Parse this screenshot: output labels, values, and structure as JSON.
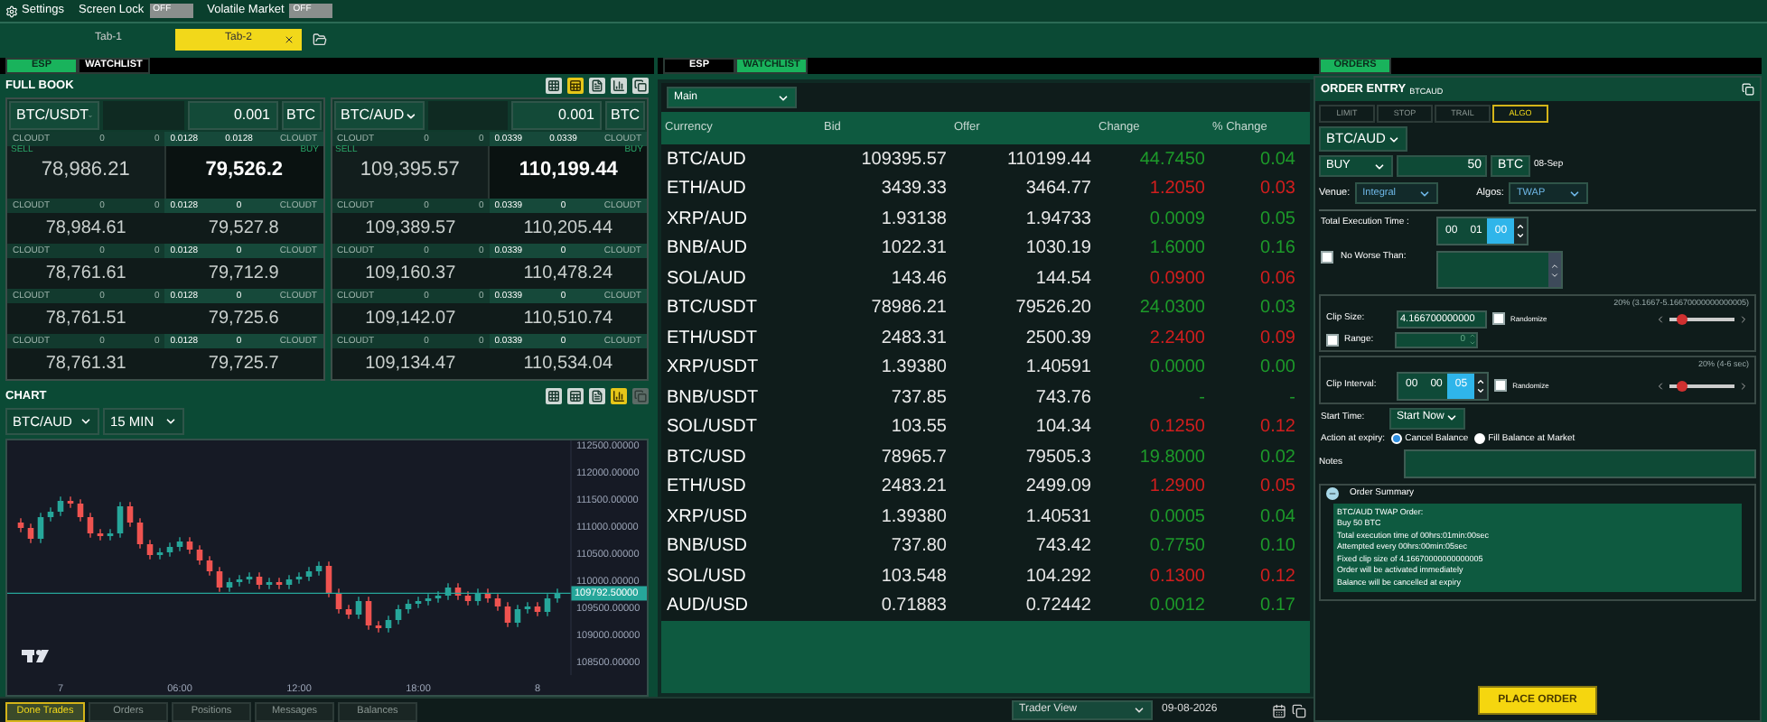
{
  "top_bar": {
    "settings": "Settings",
    "toggles": [
      {
        "label": "Screen Lock",
        "on": false,
        "state_text": "OFF"
      },
      {
        "label": "Volatile Market",
        "on": false,
        "state_text": "OFF"
      }
    ]
  },
  "workspace_tabs": [
    {
      "label": "Tab-1",
      "selected": false
    },
    {
      "label": "Tab-2",
      "selected": true
    }
  ],
  "left": {
    "tabs": [
      {
        "label": "ESP",
        "selected": true
      },
      {
        "label": "WATCHLIST",
        "selected": false
      }
    ],
    "full_book": {
      "title": "FULL BOOK",
      "tools": [
        {
          "kind": "grid",
          "selected": false,
          "disabled": false
        },
        {
          "kind": "sheet",
          "selected": true,
          "disabled": false
        },
        {
          "kind": "doc",
          "selected": false,
          "disabled": false
        },
        {
          "kind": "chart",
          "selected": false,
          "disabled": false
        },
        {
          "kind": "windows",
          "selected": false,
          "disabled": false
        }
      ],
      "books": [
        {
          "pair": "BTC/USDT",
          "quantity": "0.001",
          "unit": "BTC",
          "sell_label": "SELL",
          "buy_label": "BUY",
          "levels": [
            {
              "strip": [
                "CLOUDT",
                "0",
                "0",
                "0.0128",
                "0.0128",
                "CLOUDT"
              ],
              "sell": "78,986.21",
              "buy": "79,526.2"
            },
            {
              "strip": [
                "CLOUDT",
                "0",
                "0",
                "0.0128",
                "0",
                "CLOUDT"
              ],
              "sell": "78,984.61",
              "buy": "79,527.8"
            },
            {
              "strip": [
                "CLOUDT",
                "0",
                "0",
                "0.0128",
                "0",
                "CLOUDT"
              ],
              "sell": "78,761.61",
              "buy": "79,712.9"
            },
            {
              "strip": [
                "CLOUDT",
                "0",
                "0",
                "0.0128",
                "0",
                "CLOUDT"
              ],
              "sell": "78,761.51",
              "buy": "79,725.6"
            },
            {
              "strip": [
                "CLOUDT",
                "0",
                "0",
                "0.0128",
                "0",
                "CLOUDT"
              ],
              "sell": "78,761.31",
              "buy": "79,725.7"
            }
          ]
        },
        {
          "pair": "BTC/AUD",
          "quantity": "0.001",
          "unit": "BTC",
          "sell_label": "SELL",
          "buy_label": "BUY",
          "levels": [
            {
              "strip": [
                "CLOUDT",
                "0",
                "0",
                "0.0339",
                "0.0339",
                "CLOUDT"
              ],
              "sell": "109,395.57",
              "buy": "110,199.44"
            },
            {
              "strip": [
                "CLOUDT",
                "0",
                "0",
                "0.0339",
                "0",
                "CLOUDT"
              ],
              "sell": "109,389.57",
              "buy": "110,205.44"
            },
            {
              "strip": [
                "CLOUDT",
                "0",
                "0",
                "0.0339",
                "0",
                "CLOUDT"
              ],
              "sell": "109,160.37",
              "buy": "110,478.24"
            },
            {
              "strip": [
                "CLOUDT",
                "0",
                "0",
                "0.0339",
                "0",
                "CLOUDT"
              ],
              "sell": "109,142.07",
              "buy": "110,510.74"
            },
            {
              "strip": [
                "CLOUDT",
                "0",
                "0",
                "0.0339",
                "0",
                "CLOUDT"
              ],
              "sell": "109,134.47",
              "buy": "110,534.04"
            }
          ]
        }
      ]
    },
    "chart": {
      "title": "CHART",
      "tools": [
        {
          "kind": "grid",
          "selected": false,
          "disabled": false
        },
        {
          "kind": "sheet",
          "selected": false,
          "disabled": false
        },
        {
          "kind": "doc",
          "selected": false,
          "disabled": false
        },
        {
          "kind": "chart",
          "selected": true,
          "disabled": false
        },
        {
          "kind": "windows",
          "selected": false,
          "disabled": true
        }
      ],
      "pair": "BTC/AUD",
      "interval": "15 MIN",
      "chart_data": {
        "type": "candlestick",
        "ref_lines": [
          {
            "axis": "y",
            "value": 109792.5,
            "label": "109792.50000"
          }
        ],
        "categories": [
          null,
          null,
          null,
          null,
          "7",
          null,
          null,
          null,
          null,
          null,
          null,
          null,
          null,
          null,
          null,
          null,
          "06:00",
          null,
          null,
          null,
          null,
          null,
          null,
          null,
          null,
          null,
          null,
          null,
          "12:00",
          null,
          null,
          null,
          null,
          null,
          null,
          null,
          null,
          null,
          null,
          null,
          "18:00",
          null,
          null,
          null,
          null,
          null,
          null,
          null,
          null,
          null,
          null,
          null,
          "8",
          null,
          null
        ],
        "ohlc": [
          [
            111100,
            111180,
            110920,
            111000
          ],
          [
            111000,
            111080,
            110720,
            110800
          ],
          [
            110800,
            111280,
            110720,
            111200
          ],
          [
            111200,
            111380,
            111120,
            111300
          ],
          [
            111300,
            111580,
            111220,
            111500
          ],
          [
            111500,
            111580,
            111370,
            111450
          ],
          [
            111450,
            111530,
            111120,
            111200
          ],
          [
            111200,
            111280,
            110820,
            110900
          ],
          [
            110900,
            110980,
            110770,
            110850
          ],
          [
            110850,
            110980,
            110770,
            110900
          ],
          [
            110900,
            111480,
            110820,
            111400
          ],
          [
            111400,
            111480,
            111020,
            111100
          ],
          [
            111100,
            111180,
            110620,
            110700
          ],
          [
            110700,
            110780,
            110420,
            110500
          ],
          [
            110500,
            110630,
            110420,
            110550
          ],
          [
            110550,
            110730,
            110470,
            110650
          ],
          [
            110650,
            110830,
            110570,
            110750
          ],
          [
            110750,
            110830,
            110520,
            110600
          ],
          [
            110600,
            110680,
            110320,
            110400
          ],
          [
            110400,
            110480,
            110120,
            110200
          ],
          [
            110200,
            110280,
            109820,
            109900
          ],
          [
            109900,
            110080,
            109820,
            110000
          ],
          [
            110000,
            110130,
            109920,
            110050
          ],
          [
            110050,
            110180,
            109970,
            110100
          ],
          [
            110100,
            110180,
            109870,
            109950
          ],
          [
            109950,
            110080,
            109870,
            110000
          ],
          [
            110000,
            110080,
            109870,
            109950
          ],
          [
            109950,
            110130,
            109870,
            110050
          ],
          [
            110050,
            110180,
            109970,
            110100
          ],
          [
            110100,
            110280,
            110020,
            110200
          ],
          [
            110200,
            110380,
            110120,
            110300
          ],
          [
            110300,
            110380,
            109720,
            109800
          ],
          [
            109800,
            109880,
            109420,
            109500
          ],
          [
            109500,
            109580,
            109320,
            109400
          ],
          [
            109400,
            109730,
            109320,
            109650
          ],
          [
            109650,
            109730,
            109120,
            109200
          ],
          [
            109200,
            109280,
            109070,
            109150
          ],
          [
            109150,
            109380,
            109070,
            109300
          ],
          [
            109300,
            109580,
            109220,
            109500
          ],
          [
            109500,
            109680,
            109420,
            109600
          ],
          [
            109600,
            109730,
            109520,
            109650
          ],
          [
            109650,
            109780,
            109570,
            109700
          ],
          [
            109700,
            109830,
            109620,
            109750
          ],
          [
            109750,
            109980,
            109670,
            109900
          ],
          [
            109900,
            109980,
            109670,
            109750
          ],
          [
            109750,
            109830,
            109570,
            109650
          ],
          [
            109650,
            109880,
            109570,
            109800
          ],
          [
            109800,
            109880,
            109620,
            109700
          ],
          [
            109700,
            109780,
            109470,
            109550
          ],
          [
            109550,
            109630,
            109170,
            109250
          ],
          [
            109250,
            109580,
            109170,
            109500
          ],
          [
            109500,
            109630,
            109420,
            109550
          ],
          [
            109550,
            109630,
            109370,
            109450
          ],
          [
            109450,
            109780,
            109370,
            109700
          ],
          [
            109700,
            109880,
            109620,
            109800
          ]
        ],
        "ylim": [
          108350,
          112550
        ],
        "yticks": [
          {
            "value": 112500,
            "label": "112500.00000"
          },
          {
            "value": 112000,
            "label": "112000.00000"
          },
          {
            "value": 111500,
            "label": "111500.00000"
          },
          {
            "value": 111000,
            "label": "111000.00000"
          },
          {
            "value": 110500,
            "label": "110500.00000"
          },
          {
            "value": 110000,
            "label": "110000.00000"
          },
          {
            "value": 109500,
            "label": "109500.00000"
          },
          {
            "value": 109000,
            "label": "109000.00000"
          },
          {
            "value": 108500,
            "label": "108500.00000"
          }
        ]
      }
    }
  },
  "watchlist": {
    "tabs": [
      {
        "label": "ESP",
        "selected": false
      },
      {
        "label": "WATCHLIST",
        "selected": true
      }
    ],
    "list": "Main",
    "columns": [
      "Currency",
      "Bid",
      "Offer",
      "Change",
      "% Change"
    ],
    "rows": [
      {
        "cells": [
          "BTC/AUD",
          "109395.57",
          "110199.44",
          "44.7450",
          "0.04"
        ],
        "color": "#1d9a2a"
      },
      {
        "cells": [
          "ETH/AUD",
          "3439.33",
          "3464.77",
          "1.2050",
          "0.03"
        ],
        "color": "#d21e1e"
      },
      {
        "cells": [
          "XRP/AUD",
          "1.93138",
          "1.94733",
          "0.0009",
          "0.05"
        ],
        "color": "#1d9a2a"
      },
      {
        "cells": [
          "BNB/AUD",
          "1022.31",
          "1030.19",
          "1.6000",
          "0.16"
        ],
        "color": "#1d9a2a"
      },
      {
        "cells": [
          "SOL/AUD",
          "143.46",
          "144.54",
          "0.0900",
          "0.06"
        ],
        "color": "#d21e1e"
      },
      {
        "cells": [
          "BTC/USDT",
          "78986.21",
          "79526.20",
          "24.0300",
          "0.03"
        ],
        "color": "#1d9a2a"
      },
      {
        "cells": [
          "ETH/USDT",
          "2483.31",
          "2500.39",
          "2.2400",
          "0.09"
        ],
        "color": "#d21e1e"
      },
      {
        "cells": [
          "XRP/USDT",
          "1.39380",
          "1.40591",
          "0.0000",
          "0.00"
        ],
        "color": "#1d9a2a"
      },
      {
        "cells": [
          "BNB/USDT",
          "737.85",
          "743.76",
          "-",
          "-"
        ],
        "color": "#1d9a2a"
      },
      {
        "cells": [
          "SOL/USDT",
          "103.55",
          "104.34",
          "0.1250",
          "0.12"
        ],
        "color": "#d21e1e"
      },
      {
        "cells": [
          "BTC/USD",
          "78965.7",
          "79505.3",
          "19.8000",
          "0.02"
        ],
        "color": "#1d9a2a"
      },
      {
        "cells": [
          "ETH/USD",
          "2483.21",
          "2499.09",
          "1.2900",
          "0.05"
        ],
        "color": "#d21e1e"
      },
      {
        "cells": [
          "XRP/USD",
          "1.39380",
          "1.40531",
          "0.0005",
          "0.04"
        ],
        "color": "#1d9a2a"
      },
      {
        "cells": [
          "BNB/USD",
          "737.80",
          "743.42",
          "0.7750",
          "0.10"
        ],
        "color": "#1d9a2a"
      },
      {
        "cells": [
          "SOL/USD",
          "103.548",
          "104.292",
          "0.1300",
          "0.12"
        ],
        "color": "#d21e1e"
      },
      {
        "cells": [
          "AUD/USD",
          "0.71883",
          "0.72442",
          "0.0012",
          "0.17"
        ],
        "color": "#1d9a2a"
      }
    ]
  },
  "bottom_tabs": [
    {
      "label": "Done Trades",
      "selected": true
    },
    {
      "label": "Orders",
      "selected": false
    },
    {
      "label": "Positions",
      "selected": false
    },
    {
      "label": "Messages",
      "selected": false
    },
    {
      "label": "Balances",
      "selected": false
    }
  ],
  "footer": {
    "view": "Trader View",
    "date": "09-08-2026"
  },
  "orders": {
    "tabs": [
      {
        "label": "ORDERS",
        "selected": true
      }
    ],
    "title": "ORDER ENTRY",
    "subtitle": "BTCAUD",
    "order_types": [
      {
        "label": "LIMIT",
        "selected": false
      },
      {
        "label": "STOP",
        "selected": false
      },
      {
        "label": "TRAIL",
        "selected": false
      },
      {
        "label": "ALGO",
        "selected": true
      }
    ],
    "pair": "BTC/AUD",
    "side": "BUY",
    "quantity": "50",
    "unit": "BTC",
    "value_date": "08-Sep",
    "venue_label": "Venue:",
    "venue": "Integral",
    "algo_label": "Algos:",
    "algo": "TWAP",
    "exec_time": {
      "label": "Total Execution Time :",
      "hh": "00",
      "mm": "01",
      "ss": "00"
    },
    "no_worse": {
      "label": "No Worse Than:",
      "checked": false
    },
    "clip_size": {
      "label": "Clip Size:",
      "value": "4.166700000000",
      "range_text": "20% (3.1667-5.16670000000000005)",
      "randomize": {
        "label": "Randomize",
        "checked": false
      },
      "level": 0.2,
      "range": {
        "label": "Range:",
        "checked": false,
        "value": "0"
      }
    },
    "clip_interval": {
      "label": "Clip Interval:",
      "hh": "00",
      "mm": "00",
      "ss": "05",
      "range_text": "20% (4-6 sec)",
      "randomize": {
        "label": "Randomize",
        "checked": false
      },
      "level": 0.2
    },
    "start_time": {
      "label": "Start Time:",
      "value": "Start Now"
    },
    "expiry": {
      "label": "Action at expiry:",
      "options": [
        {
          "label": "Cancel Balance",
          "selected": true
        },
        {
          "label": "Fill Balance at Market",
          "selected": false
        }
      ]
    },
    "notes_label": "Notes",
    "summary": {
      "title": "Order Summary",
      "expanded": true,
      "lines": [
        "BTC/AUD TWAP Order:",
        "Buy 50 BTC",
        "Total execution time of 00hrs:01min:00sec",
        "Attempted every 00hrs:00min:05sec",
        "Fixed clip size of 4.16670000000000005",
        "Order will be activated immediately",
        "Balance will be cancelled at expiry"
      ]
    },
    "submit": "PLACE ORDER"
  }
}
